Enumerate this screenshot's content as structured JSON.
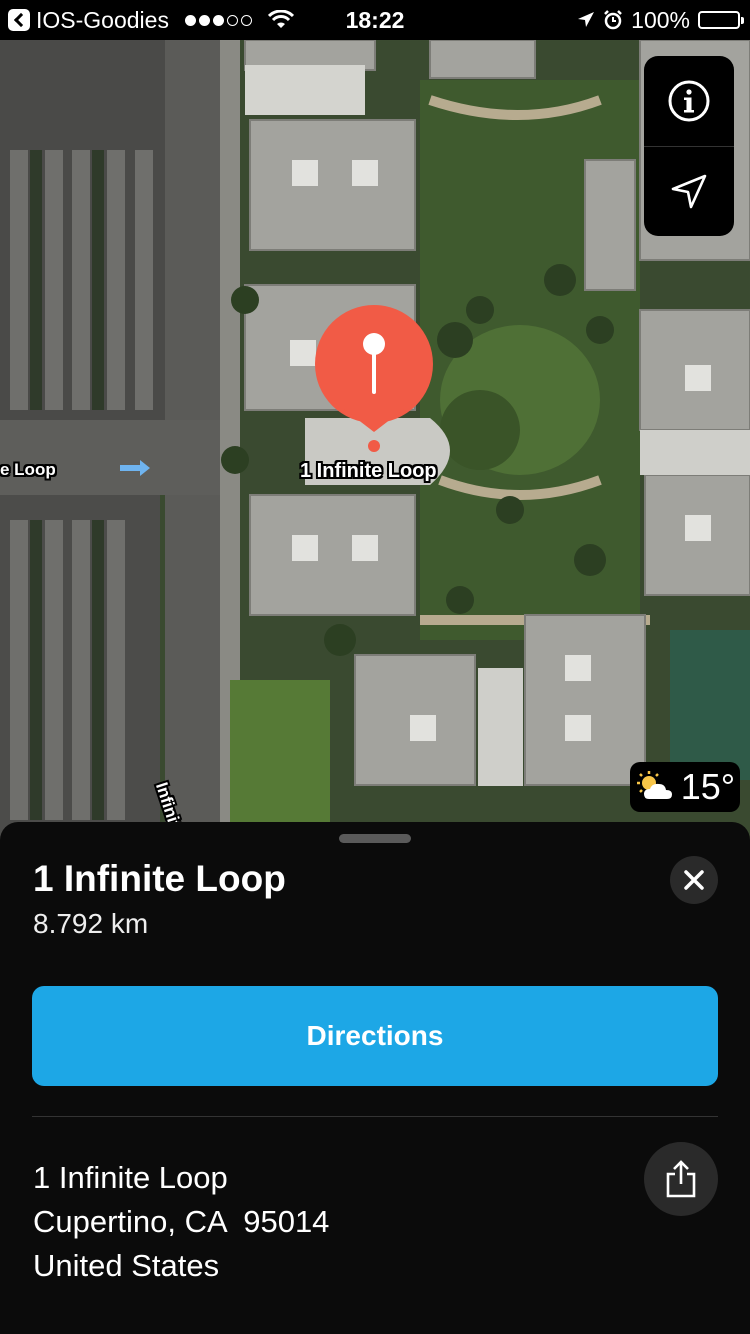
{
  "status_bar": {
    "back_app": "IOS-Goodies",
    "time": "18:22",
    "battery": "100%",
    "signal_bars_filled": 3,
    "signal_bars_total": 5
  },
  "map": {
    "pin_label": "1 Infinite Loop",
    "street_label_left": "e Loop",
    "street_label_vertical": "Infinite Loop",
    "weather_temp": "15°",
    "icons": {
      "info": "info-icon",
      "location": "location-arrow-icon",
      "weather": "partly-cloudy-icon"
    }
  },
  "sheet": {
    "title": "1 Infinite Loop",
    "distance": "8.792 km",
    "directions_label": "Directions",
    "address_line1": "1 Infinite Loop",
    "address_line2": "Cupertino, CA  95014",
    "address_line3": "United States"
  },
  "colors": {
    "accent": "#1da7e6",
    "pin": "#f15b46",
    "sheet_bg": "#0b0b0b"
  }
}
